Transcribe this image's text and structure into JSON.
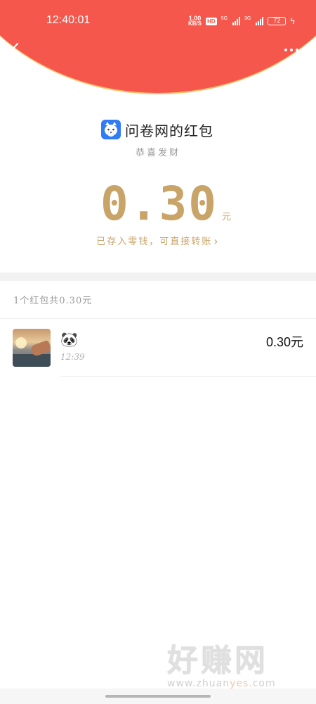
{
  "status_bar": {
    "time": "12:40:01",
    "net_speed_value": "1.00",
    "net_speed_unit": "KB/S",
    "hd_label": "HD",
    "sig1_label": "5G",
    "sig2_label": "3G",
    "battery_level": "72"
  },
  "header": {
    "background_color": "#f5574c",
    "border_color": "#f6c36a",
    "back_icon": "chevron-left-icon",
    "more_icon": "more-dots-icon"
  },
  "envelope": {
    "app_icon": "fox-app-icon",
    "sender_name": "问卷网的红包",
    "blessing": "恭喜发财",
    "amount": "0.30",
    "amount_unit": "元",
    "saved_text": "已存入零钱，可直接转账",
    "accent_color": "#c9a468"
  },
  "summary": {
    "text": "1个红包共0.30元"
  },
  "records": [
    {
      "avatar": "beach-photo-avatar",
      "name": "🐼",
      "time": "12:39",
      "amount": "0.30元"
    }
  ],
  "watermark": {
    "big": "好赚网",
    "small_prefix": "www.zhuan",
    "small_highlight": "yes",
    "small_suffix": ".com"
  }
}
